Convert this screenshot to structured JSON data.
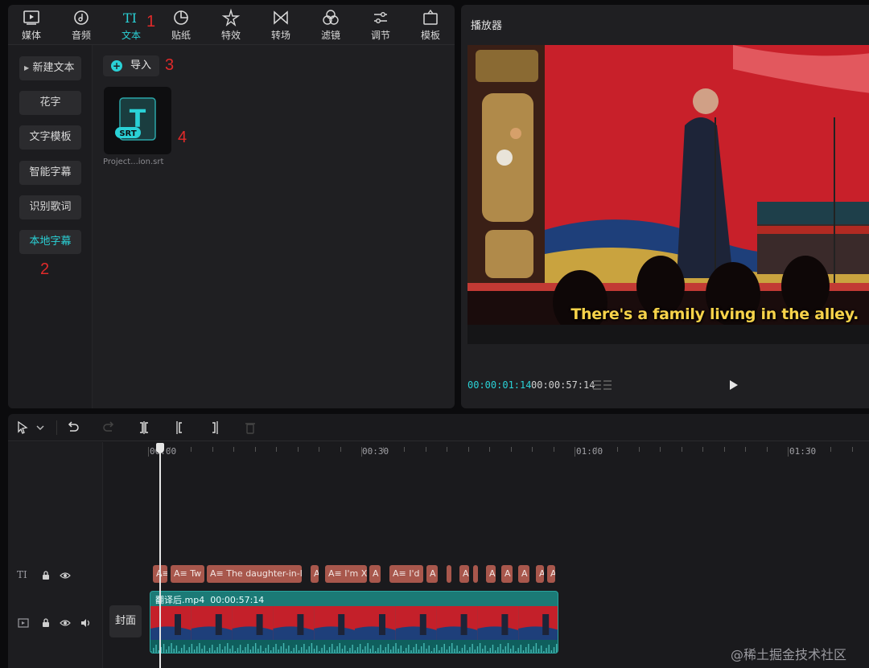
{
  "toolbar": {
    "tools": [
      {
        "id": "media",
        "label": "媒体",
        "icon": "media-icon"
      },
      {
        "id": "audio",
        "label": "音频",
        "icon": "audio-icon"
      },
      {
        "id": "text",
        "label": "文本",
        "icon": "text-icon",
        "active": true
      },
      {
        "id": "sticker",
        "label": "贴纸",
        "icon": "sticker-icon"
      },
      {
        "id": "effects",
        "label": "特效",
        "icon": "effects-icon"
      },
      {
        "id": "transition",
        "label": "转场",
        "icon": "transition-icon"
      },
      {
        "id": "filter",
        "label": "滤镜",
        "icon": "filter-icon"
      },
      {
        "id": "adjust",
        "label": "调节",
        "icon": "adjust-icon"
      },
      {
        "id": "template",
        "label": "模板",
        "icon": "template-icon"
      }
    ]
  },
  "annotations": {
    "n1": "1",
    "n2": "2",
    "n3": "3",
    "n4": "4"
  },
  "sidebar": {
    "items": [
      {
        "label": "新建文本"
      },
      {
        "label": "花字"
      },
      {
        "label": "文字模板"
      },
      {
        "label": "智能字幕"
      },
      {
        "label": "识别歌词"
      },
      {
        "label": "本地字幕",
        "active": true
      }
    ]
  },
  "content": {
    "import_label": "导入",
    "file": {
      "badge": "SRT",
      "glyph": "T",
      "name": "Project...ion.srt"
    }
  },
  "player": {
    "title": "播放器",
    "subtitle": "There's a family living in the alley.",
    "current_time": "00:00:01:14",
    "total_time": "00:00:57:14"
  },
  "timeline": {
    "ruler": [
      "00:00",
      "00:30",
      "01:00",
      "01:30"
    ],
    "text_clips": [
      {
        "label": "A≡"
      },
      {
        "label": "A≡ Tw"
      },
      {
        "label": "A≡ The daughter-in-la"
      },
      {
        "label": "A"
      },
      {
        "label": "A≡ I'm X"
      },
      {
        "label": "A"
      },
      {
        "label": "A≡ I'd"
      },
      {
        "label": "A"
      },
      {
        "label": ""
      },
      {
        "label": "A"
      },
      {
        "label": ""
      },
      {
        "label": "A"
      },
      {
        "label": "A"
      },
      {
        "label": "A"
      },
      {
        "label": "A"
      },
      {
        "label": "A"
      }
    ],
    "video_clip": {
      "name": "翻译后.mp4",
      "duration": "00:00:57:14"
    },
    "cover_label": "封面",
    "text_track_icon": "TI"
  },
  "watermark": "@稀土掘金技术社区",
  "colors": {
    "accent": "#2ad1d6",
    "clip_text": "#a8574c",
    "clip_video": "#1b7a76",
    "annotation": "#e02a2a"
  }
}
